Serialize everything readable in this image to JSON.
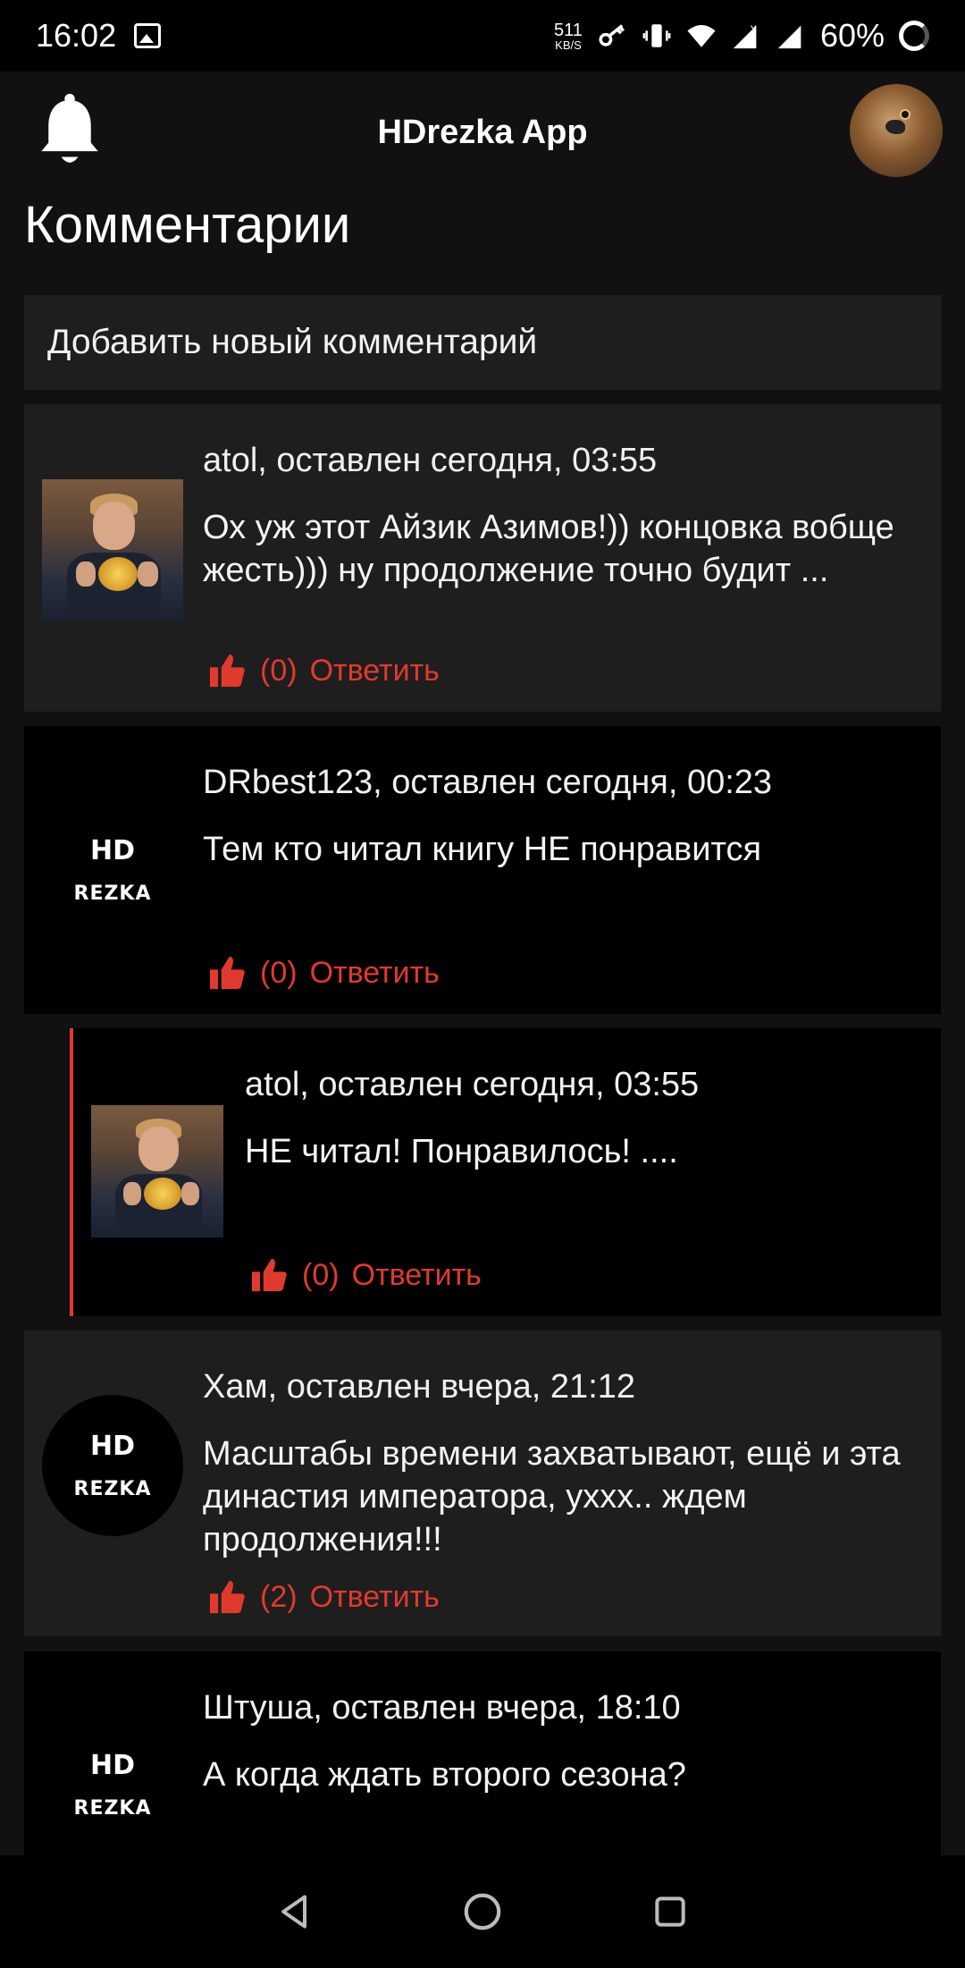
{
  "status_bar": {
    "time": "16:02",
    "speed_value": "511",
    "speed_unit": "KB/S",
    "battery": "60%"
  },
  "app_bar": {
    "title": "HDrezka App"
  },
  "page": {
    "title": "Комментарии",
    "add_comment_label": "Добавить новый комментарий"
  },
  "comments": [
    {
      "meta": "atol, оставлен сегодня, 03:55",
      "text": "Ох уж этот Айзик Азимов!)) концовка вобще жесть))) ну продолжение точно будит ...",
      "likes": "(0)",
      "reply_label": "Ответить"
    },
    {
      "meta": "DRbest123, оставлен сегодня, 00:23",
      "text": "Тем кто читал книгу НЕ понравится",
      "likes": "(0)",
      "reply_label": "Ответить"
    },
    {
      "meta": "atol, оставлен сегодня, 03:55",
      "text": "НЕ читал! Понравилось! ....",
      "likes": "(0)",
      "reply_label": "Ответить"
    },
    {
      "meta": "Хам, оставлен вчера, 21:12",
      "text": "Масштабы времени захватывают, ещё и эта династия императора, уххх.. ждем продолжения!!!",
      "likes": "(2)",
      "reply_label": "Ответить"
    },
    {
      "meta": "Штуша, оставлен вчера, 18:10",
      "text": "А когда ждать второго сезона?"
    }
  ],
  "logo": {
    "hd": "HD",
    "rezka": "REZKA"
  },
  "colors": {
    "accent": "#e03a2e",
    "background": "#111111",
    "card_gray": "#1e1e1e",
    "card_black": "#000000"
  },
  "icons": {
    "notifications": "bell-icon",
    "like": "thumb-up-icon",
    "nav_back": "triangle-back-icon",
    "nav_home": "circle-home-icon",
    "nav_recents": "square-recents-icon"
  }
}
